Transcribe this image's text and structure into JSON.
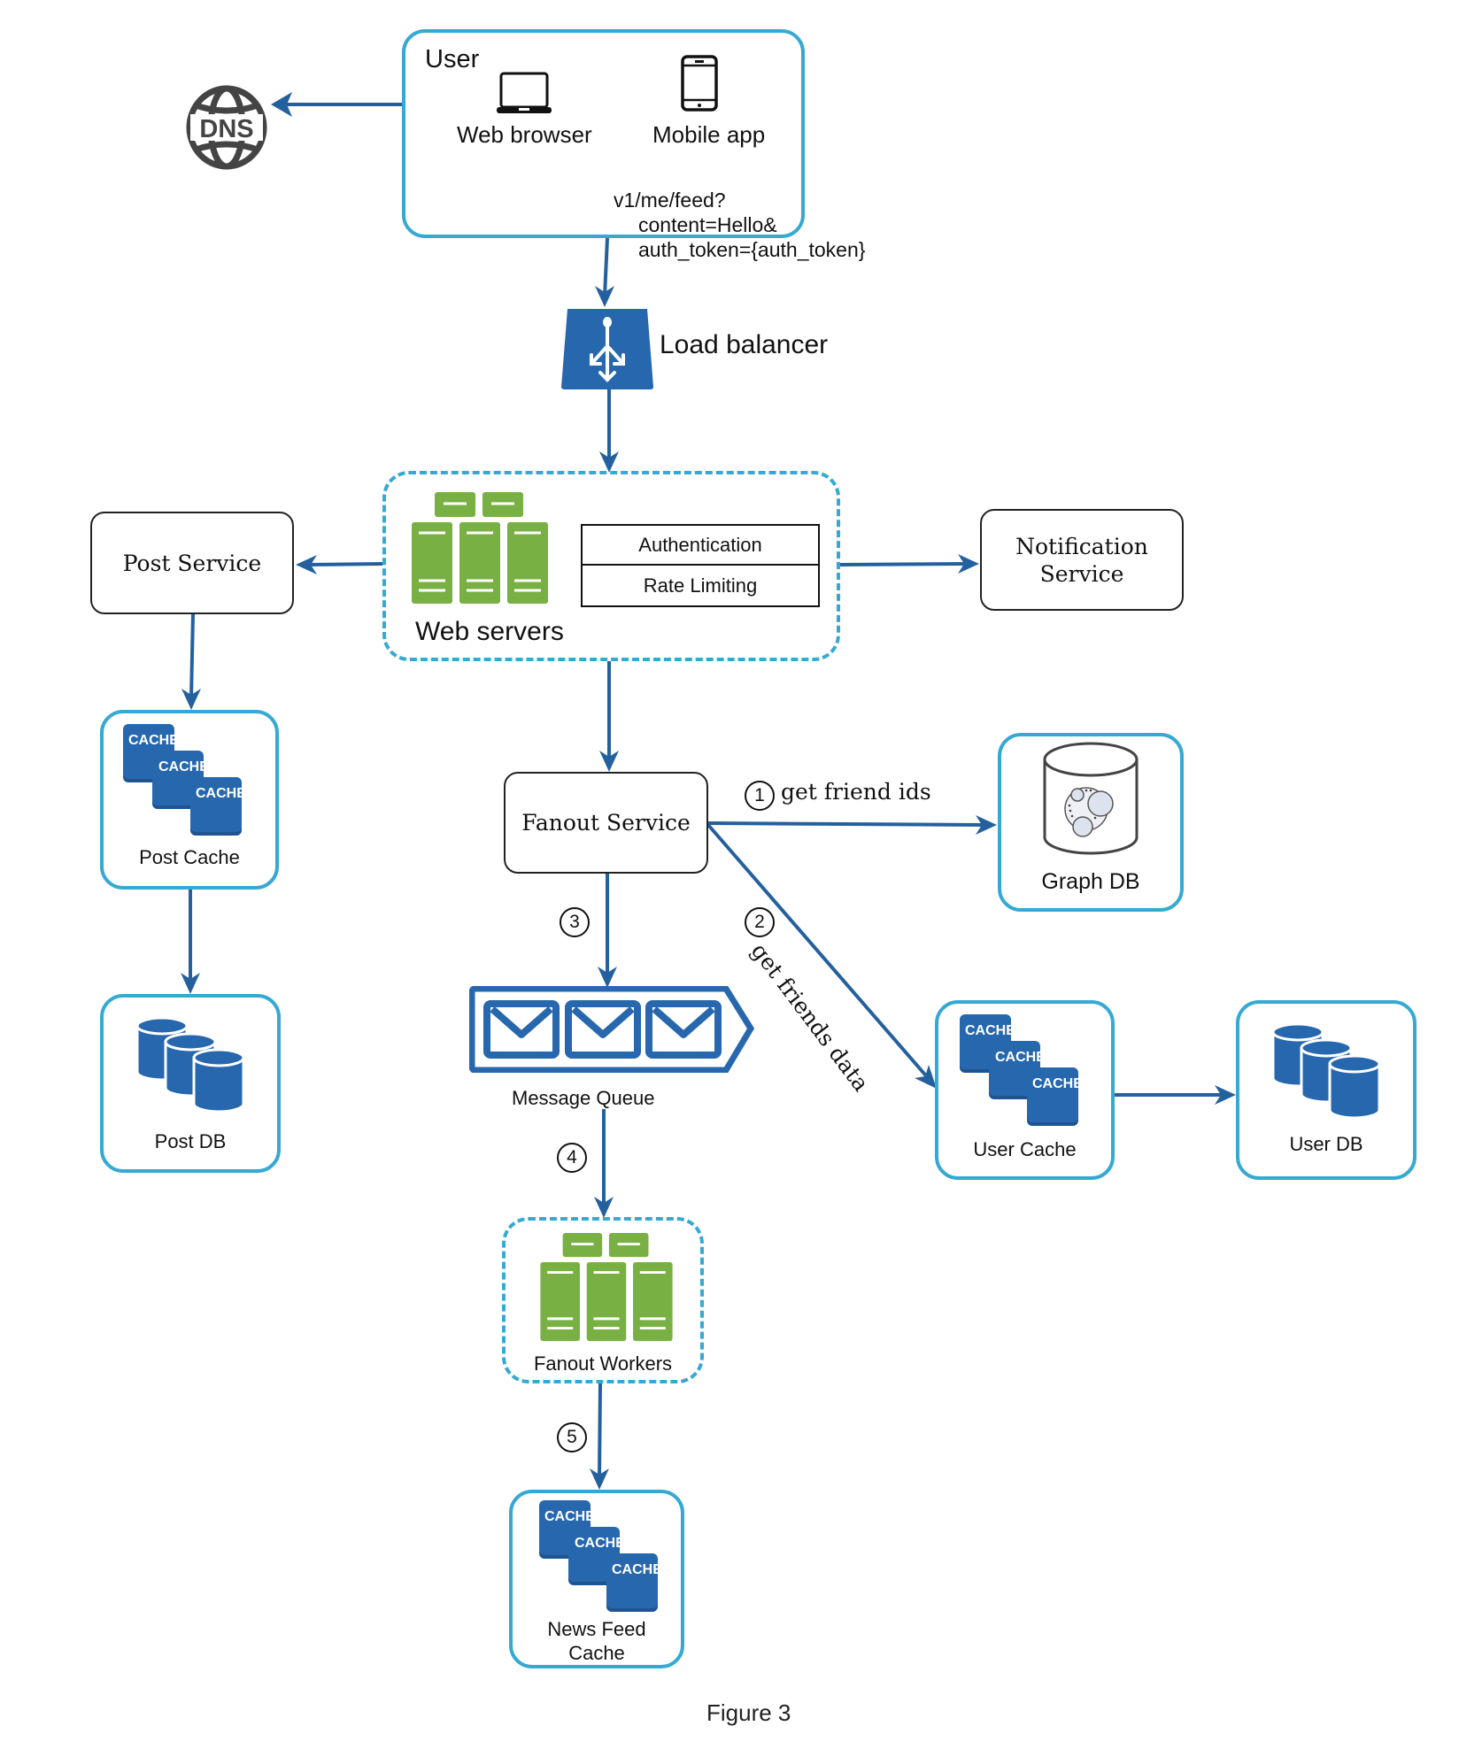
{
  "figure_caption": "Figure 3",
  "colors": {
    "arrow": "#25609e",
    "container_border": "#36a9d3",
    "icon_blue": "#2767ae",
    "server_green": "#78b043",
    "dns_gray": "#444444"
  },
  "user": {
    "title": "User",
    "clients": [
      {
        "label": "Web browser",
        "icon": "laptop-icon"
      },
      {
        "label": "Mobile app",
        "icon": "mobile-phone-icon"
      }
    ]
  },
  "dns": {
    "label": "DNS",
    "icon": "dns-globe-icon"
  },
  "request": {
    "lines": [
      "v1/me/feed?",
      "content=Hello&",
      "auth_token={auth_token}"
    ]
  },
  "load_balancer": {
    "label": "Load balancer",
    "icon": "load-balancer-icon"
  },
  "web_servers": {
    "label": "Web servers",
    "icon": "server-cluster-icon",
    "middleware": [
      "Authentication",
      "Rate Limiting"
    ]
  },
  "post_service": {
    "label": "Post Service"
  },
  "notification_service": {
    "label_lines": [
      "Notification",
      "Service"
    ]
  },
  "post_cache": {
    "label": "Post Cache",
    "cache_labels": [
      "CACHE",
      "CACHE",
      "CACHE"
    ]
  },
  "post_db": {
    "label": "Post DB"
  },
  "fanout_service": {
    "label": "Fanout Service"
  },
  "graph_db": {
    "label": "Graph DB"
  },
  "user_cache": {
    "label": "User Cache",
    "cache_labels": [
      "CACHE",
      "CACHE",
      "CACHE"
    ]
  },
  "user_db": {
    "label": "User DB"
  },
  "message_queue": {
    "label": "Message Queue"
  },
  "fanout_workers": {
    "label": "Fanout Workers"
  },
  "news_feed_cache": {
    "label_lines": [
      "News Feed",
      "Cache"
    ],
    "cache_labels": [
      "CACHE",
      "CACHE",
      "CACHE"
    ]
  },
  "steps": [
    {
      "number": "1",
      "label": "get friend ids"
    },
    {
      "number": "2",
      "label": "get friends data"
    },
    {
      "number": "3",
      "label": ""
    },
    {
      "number": "4",
      "label": ""
    },
    {
      "number": "5",
      "label": ""
    }
  ]
}
